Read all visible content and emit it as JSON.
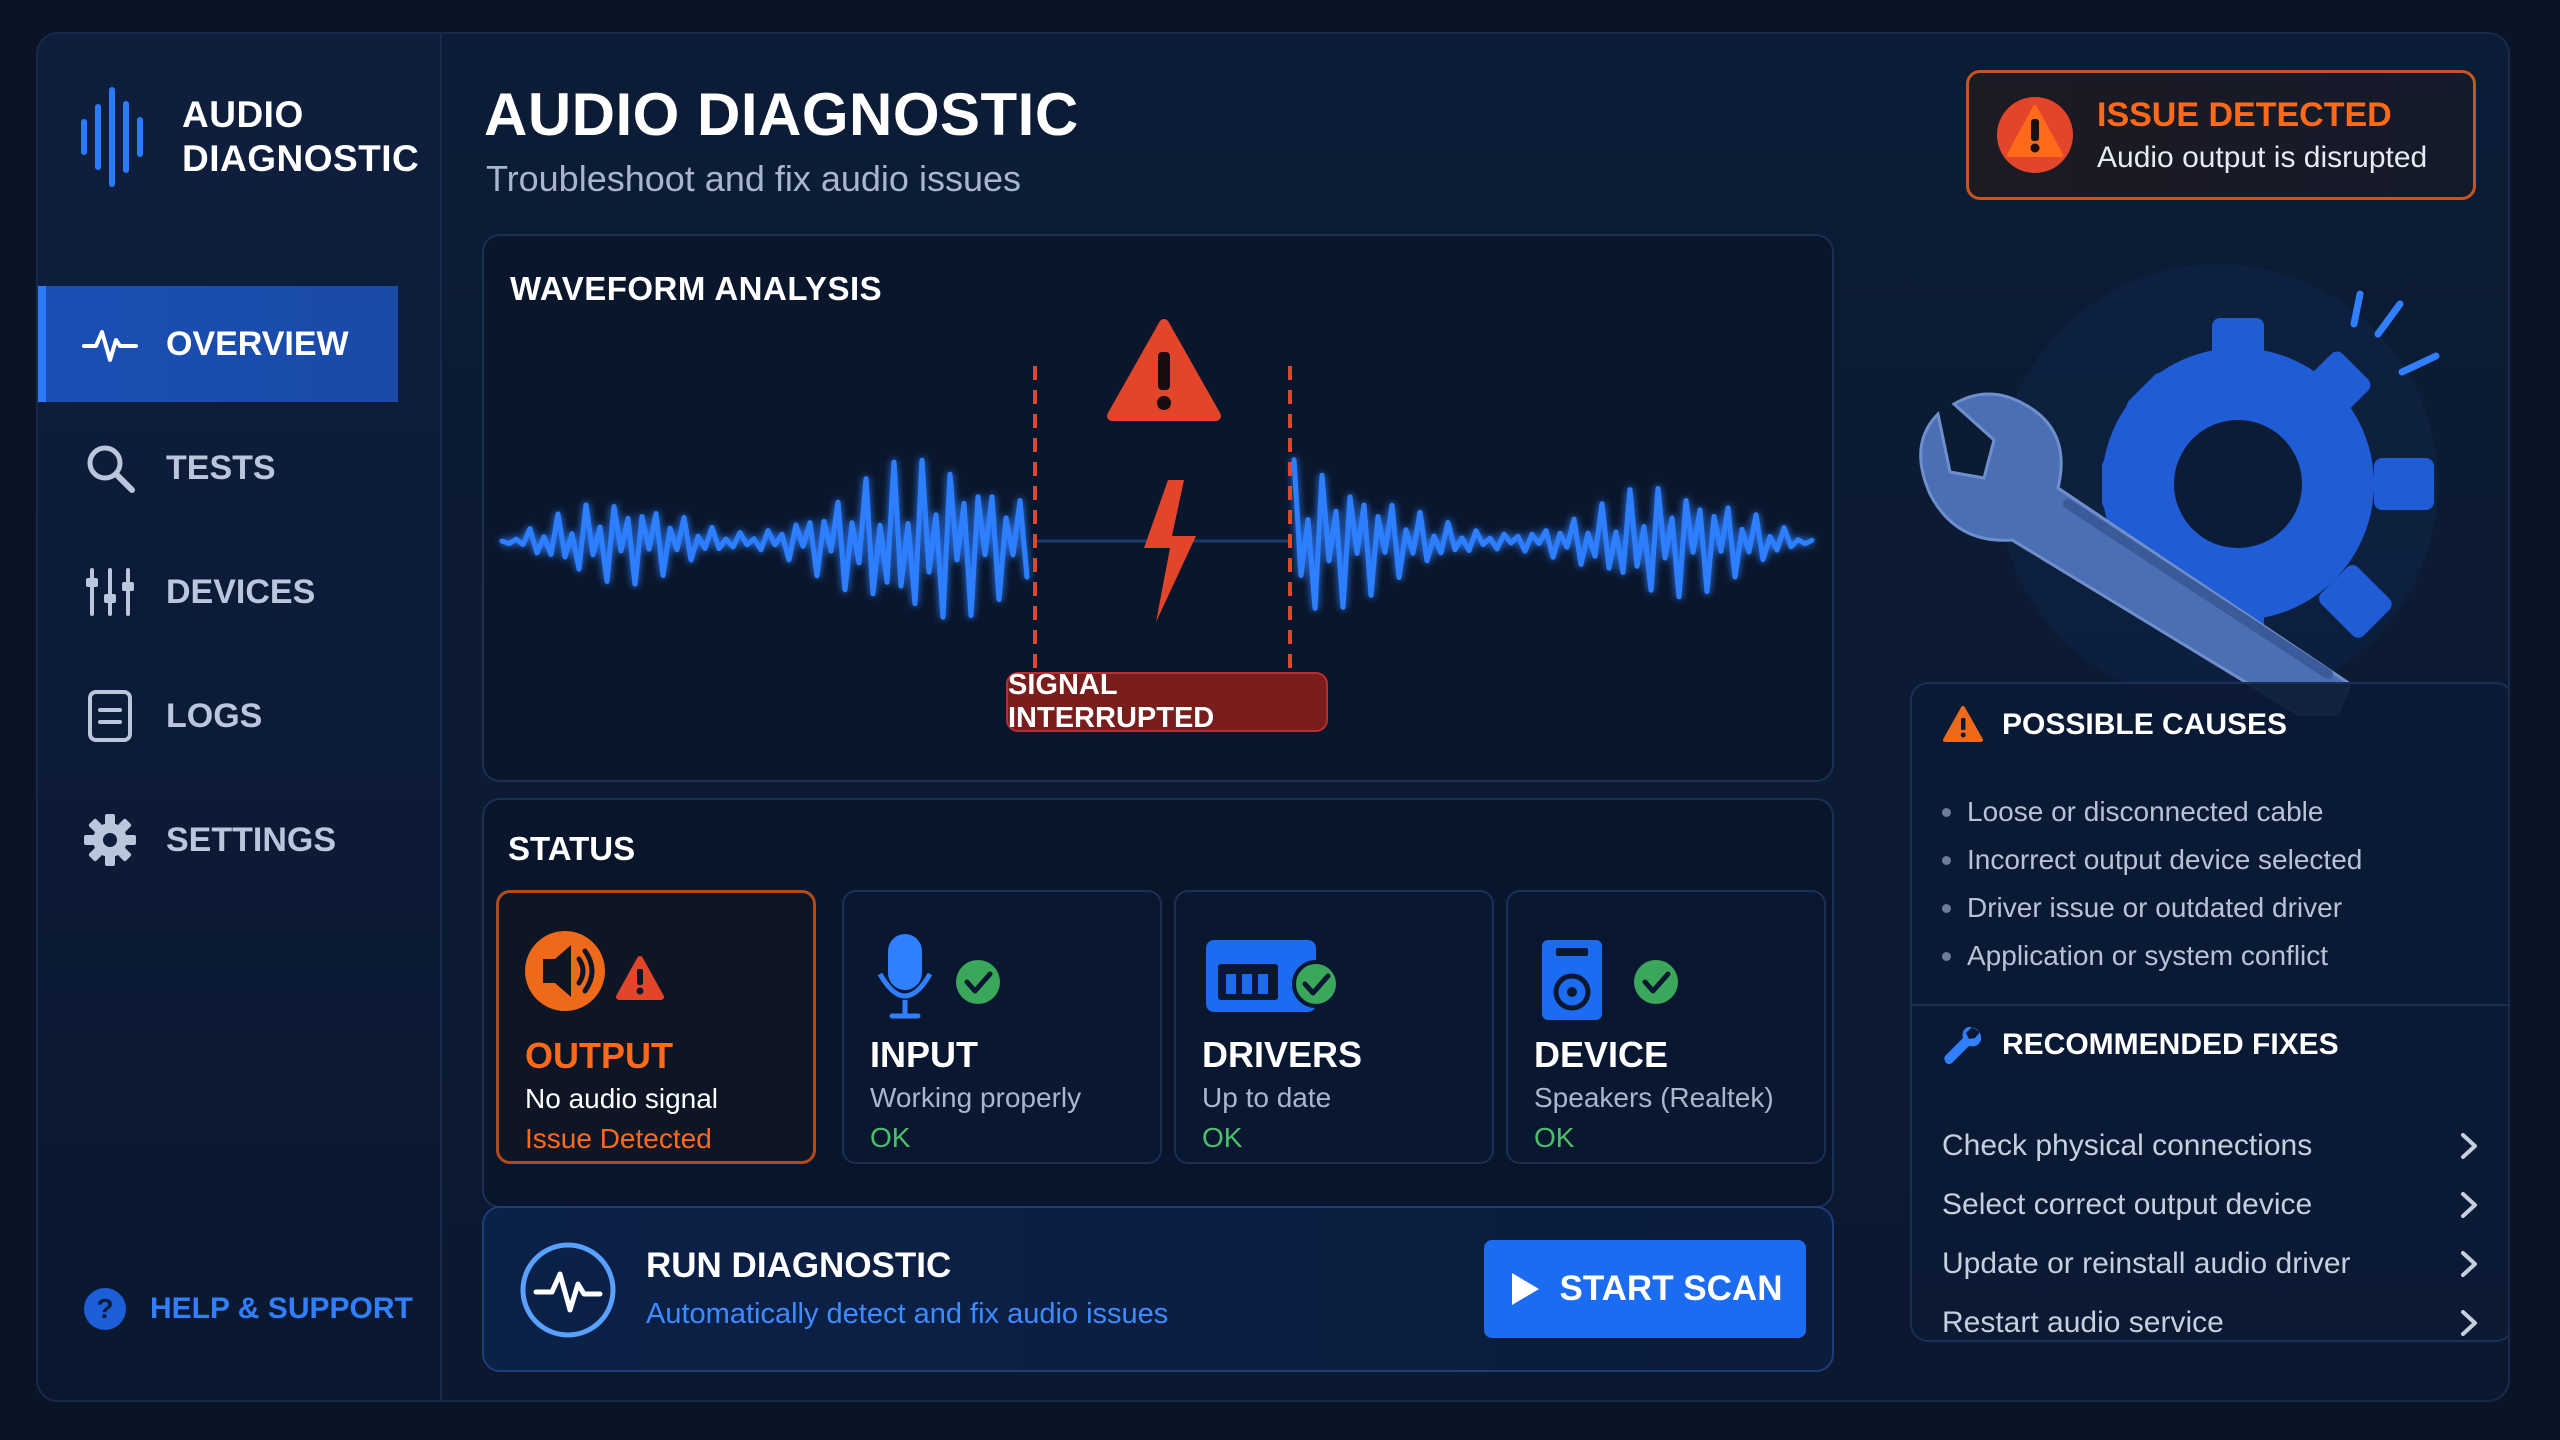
{
  "brand": {
    "line1": "AUDIO",
    "line2": "DIAGNOSTIC"
  },
  "nav": [
    {
      "label": "OVERVIEW",
      "icon": "pulse-icon",
      "active": true
    },
    {
      "label": "TESTS",
      "icon": "search-icon"
    },
    {
      "label": "DEVICES",
      "icon": "sliders-icon"
    },
    {
      "label": "LOGS",
      "icon": "document-icon"
    },
    {
      "label": "SETTINGS",
      "icon": "gear-icon"
    }
  ],
  "help": {
    "label": "HELP & SUPPORT",
    "icon": "question-icon"
  },
  "header": {
    "title": "AUDIO DIAGNOSTIC",
    "subtitle": "Troubleshoot and fix audio issues"
  },
  "issue_banner": {
    "title": "ISSUE DETECTED",
    "message": "Audio output is disrupted",
    "icon": "warning-icon",
    "color": "#ff6a1a"
  },
  "waveform": {
    "title": "WAVEFORM ANALYSIS",
    "badge": "SIGNAL INTERRUPTED"
  },
  "status": {
    "title": "STATUS",
    "cards": [
      {
        "name": "OUTPUT",
        "desc": "No audio signal",
        "state": "Issue Detected",
        "icon": "speaker-icon",
        "status_icon": "warning-icon"
      },
      {
        "name": "INPUT",
        "desc": "Working properly",
        "state": "OK",
        "icon": "microphone-icon",
        "status_icon": "check-icon"
      },
      {
        "name": "DRIVERS",
        "desc": "Up to date",
        "state": "OK",
        "icon": "driver-card-icon",
        "status_icon": "check-icon"
      },
      {
        "name": "DEVICE",
        "desc": "Speakers (Realtek)",
        "state": "OK",
        "icon": "speaker-box-icon",
        "status_icon": "check-icon"
      }
    ]
  },
  "run": {
    "title": "RUN DIAGNOSTIC",
    "subtitle": "Automatically detect and fix audio issues",
    "button": "START SCAN"
  },
  "causes": {
    "title": "POSSIBLE CAUSES",
    "items": [
      "Loose or disconnected cable",
      "Incorrect output device selected",
      "Driver issue or outdated driver",
      "Application or system conflict"
    ]
  },
  "fixes": {
    "title": "RECOMMENDED FIXES",
    "items": [
      "Check physical connections",
      "Select correct output device",
      "Update or reinstall audio driver",
      "Restart audio service"
    ]
  },
  "colors": {
    "accent": "#1c6cf2",
    "warning": "#ff6a1a",
    "error": "#e2452a",
    "ok": "#4ac06a"
  }
}
